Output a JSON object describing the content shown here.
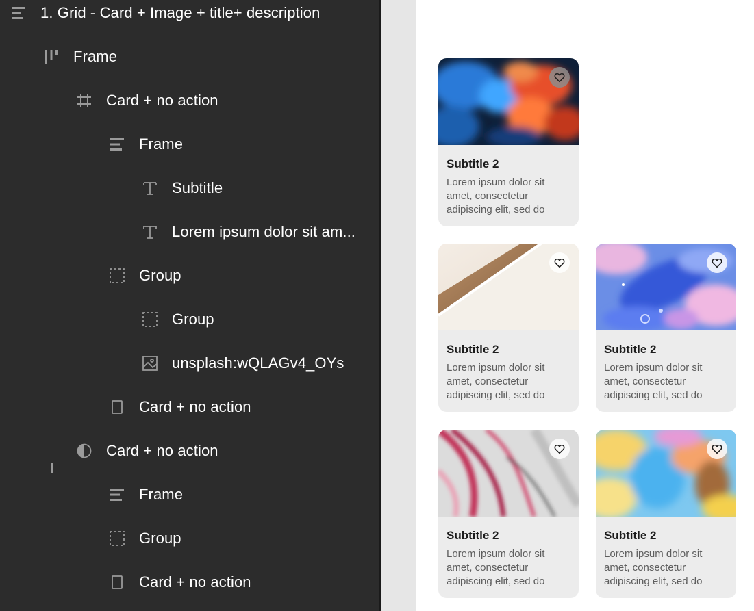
{
  "layers_panel": {
    "rows": [
      {
        "label": "1. Grid - Card + Image + title+ description",
        "icon": "auto-layout-vertical-icon"
      },
      {
        "label": "Frame",
        "icon": "auto-layout-horizontal-icon"
      },
      {
        "label": "Card + no action",
        "icon": "frame-grid-icon"
      },
      {
        "label": "Frame",
        "icon": "auto-layout-vertical-icon"
      },
      {
        "label": "Subtitle",
        "icon": "text-icon"
      },
      {
        "label": "Lorem ipsum dolor sit am...",
        "icon": "text-icon"
      },
      {
        "label": "Group",
        "icon": "group-icon"
      },
      {
        "label": "Group",
        "icon": "group-icon"
      },
      {
        "label": "unsplash:wQLAGv4_OYs",
        "icon": "image-icon"
      },
      {
        "label": "Card + no action",
        "icon": "rectangle-icon"
      },
      {
        "label": "Card + no action",
        "icon": "component-instance-icon"
      },
      {
        "label": "Frame",
        "icon": "auto-layout-vertical-icon"
      },
      {
        "label": "Group",
        "icon": "group-icon"
      },
      {
        "label": "Card + no action",
        "icon": "rectangle-icon"
      }
    ]
  },
  "canvas": {
    "cards": [
      {
        "title": "Subtitle 2",
        "description": "Lorem ipsum dolor sit amet, consectetur adipiscing elit, sed do",
        "image": "ink-smoke-blue-orange",
        "favorite_icon": "heart-outline-icon"
      },
      {
        "title": "Subtitle 2",
        "description": "Lorem ipsum dolor sit amet, consectetur adipiscing elit, sed do",
        "image": "beige-wood-curve",
        "favorite_icon": "heart-outline-icon"
      },
      {
        "title": "Subtitle 2",
        "description": "Lorem ipsum dolor sit amet, consectetur adipiscing elit, sed do",
        "image": "blue-pink-fluid",
        "favorite_icon": "heart-outline-icon"
      },
      {
        "title": "Subtitle 2",
        "description": "Lorem ipsum dolor sit amet, consectetur adipiscing elit, sed do",
        "image": "red-grey-marble",
        "favorite_icon": "heart-outline-icon"
      },
      {
        "title": "Subtitle 2",
        "description": "Lorem ipsum dolor sit amet, consectetur adipiscing elit, sed do",
        "image": "yellow-blue-fluid",
        "favorite_icon": "heart-outline-icon"
      }
    ]
  },
  "colors": {
    "panel_bg": "#2c2c2c",
    "panel_text": "#ffffff",
    "icon_grey": "#9a9a9a",
    "canvas_gutter": "#e6e6e6",
    "card_bg": "#ececec"
  }
}
